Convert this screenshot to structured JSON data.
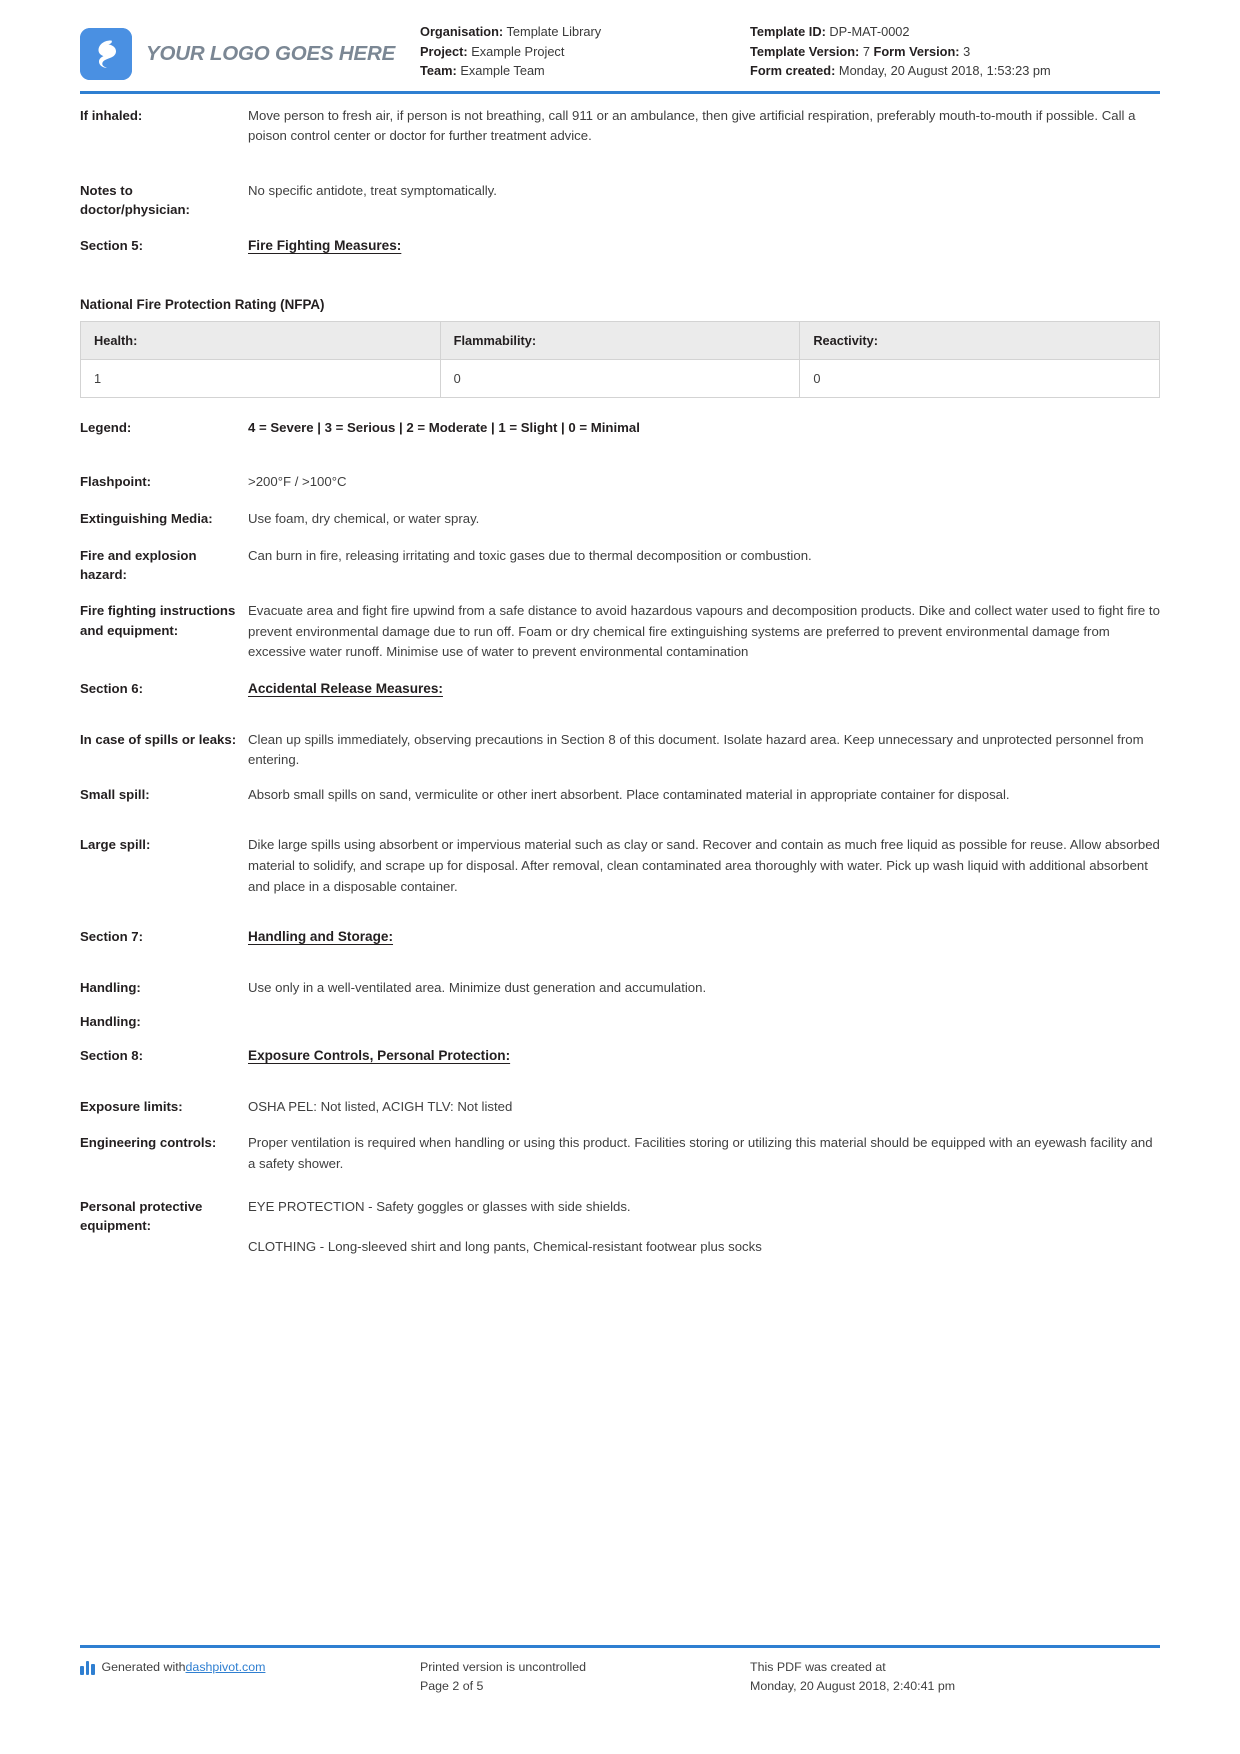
{
  "header": {
    "logo_text": "YOUR LOGO GOES HERE",
    "logo_color": "#4a90e2",
    "accent_color": "#2f7fd1",
    "left_meta": [
      {
        "key": "Organisation:",
        "value": "Template Library"
      },
      {
        "key": "Project:",
        "value": "Example Project"
      },
      {
        "key": "Team:",
        "value": "Example Team"
      }
    ],
    "right_meta": {
      "template_id_key": "Template ID:",
      "template_id_value": "DP-MAT-0002",
      "template_version_key": "Template Version:",
      "template_version_value": "7",
      "form_version_key": "Form Version:",
      "form_version_value": "3",
      "form_created_key": "Form created:",
      "form_created_value": "Monday, 20 August 2018, 1:53:23 pm"
    }
  },
  "body": {
    "if_inhaled_label": "If inhaled:",
    "if_inhaled_value": "Move person to fresh air, if person is not breathing, call 911 or an ambulance, then give artificial respiration, preferably mouth-to-mouth if possible. Call a poison control center or doctor for further treatment advice.",
    "notes_doctor_label": "Notes to doctor/physician:",
    "notes_doctor_value": "No specific antidote, treat symptomatically.",
    "section5_label": "Section 5:",
    "section5_title": "Fire Fighting Measures:",
    "nfpa_title": "National Fire Protection Rating (NFPA)",
    "nfpa_headers": [
      "Health:",
      "Flammability:",
      "Reactivity:"
    ],
    "nfpa_values": [
      "1",
      "0",
      "0"
    ],
    "legend_label": "Legend:",
    "legend_value": "4 = Severe | 3 = Serious | 2 = Moderate | 1 = Slight | 0 = Minimal",
    "flashpoint_label": "Flashpoint:",
    "flashpoint_value": ">200°F / >100°C",
    "extinguishing_label": "Extinguishing Media:",
    "extinguishing_value": "Use foam, dry chemical, or water spray.",
    "fire_explosion_label": "Fire and explosion hazard:",
    "fire_explosion_value": "Can burn in fire, releasing irritating and toxic gases due to thermal decomposition or combustion.",
    "fire_instructions_label": "Fire fighting instructions and equipment:",
    "fire_instructions_value": "Evacuate area and fight fire upwind from a safe distance to avoid hazardous vapours and decomposition products. Dike and collect water used to fight fire to prevent environmental damage due to run off. Foam or dry chemical fire extinguishing systems are preferred to prevent environmental damage from excessive water runoff. Minimise use of water to prevent environmental contamination",
    "section6_label": "Section 6:",
    "section6_title": "Accidental Release Measures:",
    "spills_leaks_label": "In case of spills or leaks:",
    "spills_leaks_value": "Clean up spills immediately, observing precautions in Section 8 of this document. Isolate hazard area. Keep unnecessary and unprotected personnel from entering.",
    "small_spill_label": "Small spill:",
    "small_spill_value": "Absorb small spills on sand, vermiculite or other inert absorbent. Place contaminated material in appropriate container for disposal.",
    "large_spill_label": "Large spill:",
    "large_spill_value": "Dike large spills using absorbent or impervious material such as clay or sand. Recover and contain as much free liquid as possible for reuse. Allow absorbed material to solidify, and scrape up for disposal. After removal, clean contaminated area thoroughly with water. Pick up wash liquid with additional absorbent and place in a disposable container.",
    "section7_label": "Section 7:",
    "section7_title": "Handling and Storage:",
    "handling_label": "Handling:",
    "handling_value": "Use only in a well-ventilated area. Minimize dust generation and accumulation.",
    "handling2_label": "Handling:",
    "handling2_value": "",
    "section8_label": "Section 8:",
    "section8_title": "Exposure Controls, Personal Protection:",
    "exposure_limits_label": "Exposure limits:",
    "exposure_limits_value": "OSHA PEL: Not listed, ACIGH TLV: Not listed",
    "engineering_controls_label": "Engineering controls:",
    "engineering_controls_value": "Proper ventilation is required when handling or using this product. Facilities storing or utilizing this material should be equipped with an eyewash facility and a safety shower.",
    "ppe_label": "Personal protective equipment:",
    "ppe_value_1": "EYE PROTECTION - Safety goggles or glasses with side shields.",
    "ppe_value_2": "CLOTHING - Long-sleeved shirt and long pants, Chemical-resistant footwear plus socks"
  },
  "footer": {
    "generated_prefix": "Generated with ",
    "generated_link": "dashpivot.com",
    "uncontrolled_line1": "Printed version is uncontrolled",
    "uncontrolled_line2": "Page 2 of 5",
    "created_line1": "This PDF was created at",
    "created_line2": "Monday, 20 August 2018, 2:40:41 pm"
  }
}
